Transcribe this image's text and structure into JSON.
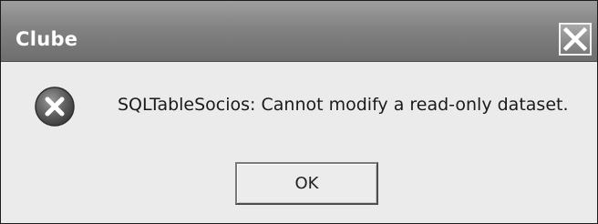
{
  "window": {
    "title": "Clube",
    "close_icon": "close-icon"
  },
  "message": {
    "icon": "error-icon",
    "text": "SQLTableSocios: Cannot modify a read-only dataset."
  },
  "buttons": {
    "ok_label": "OK"
  },
  "colors": {
    "titlebar": "#828282",
    "dialog_background": "#ebebeb",
    "title_text": "#ffffff",
    "error_icon": "#5a5a5a"
  }
}
